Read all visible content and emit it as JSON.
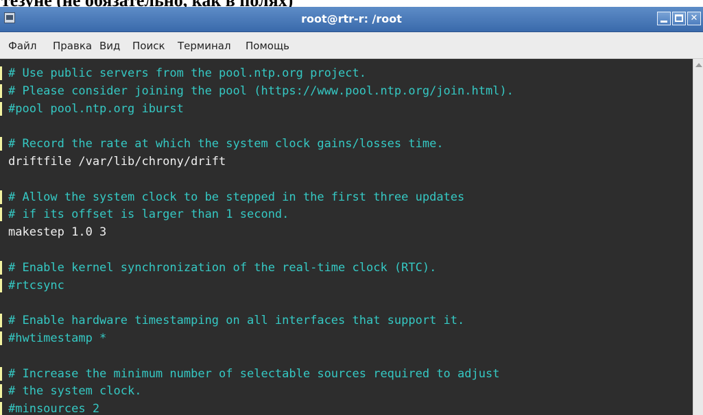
{
  "document_header": "тезуне (не обязательно, как в полях)",
  "window": {
    "title": "root@rtr-r: /root",
    "icon": "terminal-app-icon",
    "controls": [
      "minimize",
      "maximize",
      "close"
    ]
  },
  "menubar": {
    "items": [
      "Файл",
      "Правка",
      "Вид",
      "Поиск",
      "Терминал",
      "Помощь"
    ]
  },
  "terminal": {
    "lines": [
      {
        "text": "# Use public servers from the pool.ntp.org project.",
        "kind": "comment"
      },
      {
        "text": "# Please consider joining the pool (https://www.pool.ntp.org/join.html).",
        "kind": "comment"
      },
      {
        "text": "#pool pool.ntp.org iburst",
        "kind": "comment"
      },
      {
        "text": "",
        "kind": "plain"
      },
      {
        "text": "# Record the rate at which the system clock gains/losses time.",
        "kind": "comment"
      },
      {
        "text": "driftfile /var/lib/chrony/drift",
        "kind": "plain"
      },
      {
        "text": "",
        "kind": "plain"
      },
      {
        "text": "# Allow the system clock to be stepped in the first three updates",
        "kind": "comment"
      },
      {
        "text": "# if its offset is larger than 1 second.",
        "kind": "comment"
      },
      {
        "text": "makestep 1.0 3",
        "kind": "plain"
      },
      {
        "text": "",
        "kind": "plain"
      },
      {
        "text": "# Enable kernel synchronization of the real-time clock (RTC).",
        "kind": "comment"
      },
      {
        "text": "#rtcsync",
        "kind": "comment"
      },
      {
        "text": "",
        "kind": "plain"
      },
      {
        "text": "# Enable hardware timestamping on all interfaces that support it.",
        "kind": "comment"
      },
      {
        "text": "#hwtimestamp *",
        "kind": "comment"
      },
      {
        "text": "",
        "kind": "plain"
      },
      {
        "text": "# Increase the minimum number of selectable sources required to adjust",
        "kind": "comment"
      },
      {
        "text": "# the system clock.",
        "kind": "comment"
      },
      {
        "text": "#minsources 2",
        "kind": "comment"
      }
    ]
  },
  "colors": {
    "comment": "#35c9c4",
    "plain": "#f0f0f0",
    "background": "#2d2d2d",
    "titlebar": "#4a7abb"
  }
}
